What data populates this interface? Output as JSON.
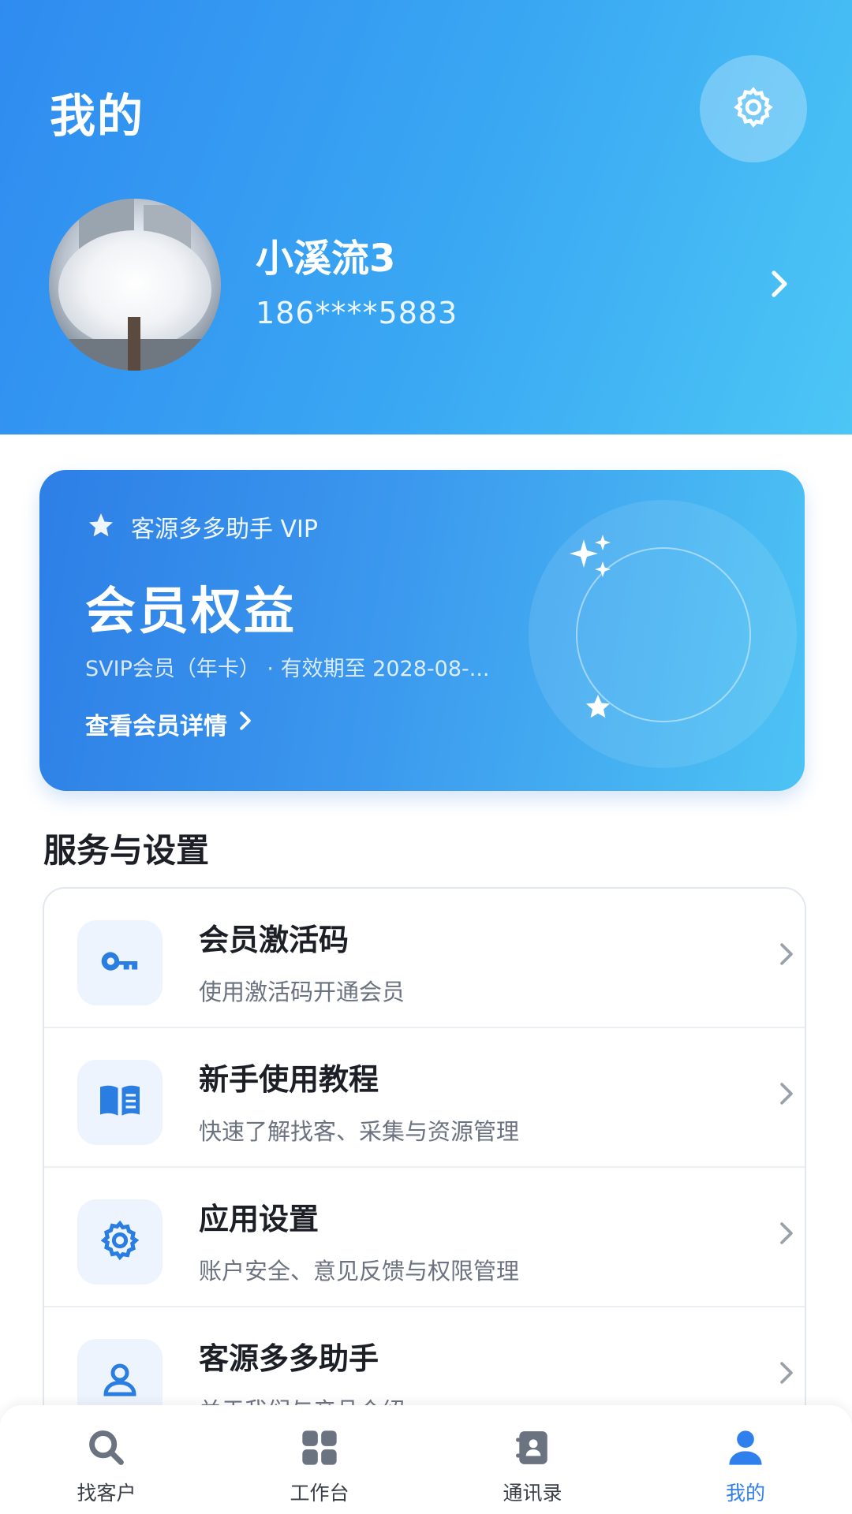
{
  "header": {
    "title": "我的",
    "settings_icon": "gear-icon"
  },
  "profile": {
    "name": "小溪流3",
    "phone": "186****5883"
  },
  "vip_card": {
    "brand": "客源多多助手 VIP",
    "title": "会员权益",
    "subtitle": "SVIP会员（年卡） · 有效期至 2028-08-...",
    "link_label": "查看会员详情"
  },
  "services": {
    "section_title": "服务与设置",
    "items": [
      {
        "title": "会员激活码",
        "desc": "使用激活码开通会员",
        "icon": "key-icon"
      },
      {
        "title": "新手使用教程",
        "desc": "快速了解找客、采集与资源管理",
        "icon": "book-icon"
      },
      {
        "title": "应用设置",
        "desc": "账户安全、意见反馈与权限管理",
        "icon": "gear-icon"
      },
      {
        "title": "客源多多助手",
        "desc": "关于我们与产品介绍",
        "icon": "user-icon"
      }
    ]
  },
  "bottom_nav": {
    "items": [
      {
        "label": "找客户",
        "icon": "search-icon",
        "active": false
      },
      {
        "label": "工作台",
        "icon": "grid-icon",
        "active": false
      },
      {
        "label": "通讯录",
        "icon": "contacts-icon",
        "active": false
      },
      {
        "label": "我的",
        "icon": "person-icon",
        "active": true
      }
    ]
  },
  "colors": {
    "accent": "#2f80ed",
    "header_gradient_start": "#2f8bf0",
    "header_gradient_end": "#4cc6f5"
  }
}
